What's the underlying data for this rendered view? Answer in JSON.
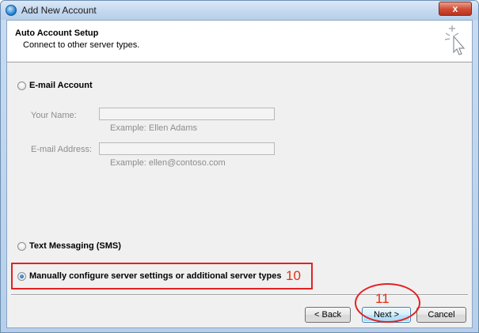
{
  "window": {
    "title": "Add New Account",
    "close_label": "x"
  },
  "header": {
    "title": "Auto Account Setup",
    "subtitle": "Connect to other server types."
  },
  "options": {
    "email_account": {
      "label": "E-mail Account",
      "selected": false
    },
    "text_messaging": {
      "label": "Text Messaging (SMS)",
      "selected": false
    },
    "manual": {
      "label": "Manually configure server settings or additional server types",
      "selected": true
    }
  },
  "fields": {
    "your_name": {
      "label": "Your Name:",
      "value": "",
      "example": "Example: Ellen Adams"
    },
    "email_address": {
      "label": "E-mail Address:",
      "value": "",
      "example": "Example: ellen@contoso.com"
    }
  },
  "annotations": {
    "step_manual": "10",
    "step_next": "11"
  },
  "buttons": {
    "back": "< Back",
    "next": "Next >",
    "cancel": "Cancel"
  },
  "colors": {
    "annotation_red": "#e32222",
    "default_button_border": "#3c7fb1",
    "title_bar": "#c2d7ef"
  }
}
